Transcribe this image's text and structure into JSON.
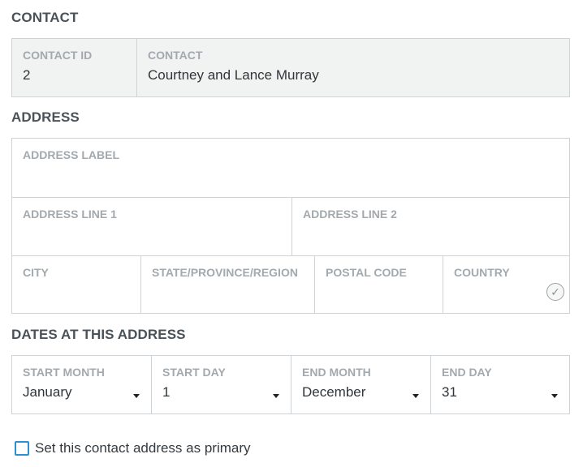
{
  "contact_section": {
    "title": "CONTACT",
    "contact_id_label": "CONTACT ID",
    "contact_id_value": "2",
    "contact_label": "CONTACT",
    "contact_value": "Courtney and Lance Murray"
  },
  "address_section": {
    "title": "ADDRESS",
    "address_label": "ADDRESS LABEL",
    "address_line1_label": "ADDRESS LINE 1",
    "address_line2_label": "ADDRESS LINE 2",
    "city_label": "CITY",
    "state_label": "STATE/PROVINCE/REGION",
    "postal_label": "POSTAL CODE",
    "country_label": "COUNTRY",
    "country_icon": "check-circle-icon"
  },
  "dates_section": {
    "title": "DATES AT THIS ADDRESS",
    "start_month_label": "START MONTH",
    "start_month_value": "January",
    "start_day_label": "START DAY",
    "start_day_value": "1",
    "end_month_label": "END MONTH",
    "end_month_value": "December",
    "end_day_label": "END DAY",
    "end_day_value": "31"
  },
  "primary": {
    "label": "Set this contact address as primary"
  },
  "colors": {
    "accent": "#2b8fd6",
    "border": "#cfd3d6",
    "label": "#a3a9ad",
    "readonly_bg": "#f1f3f3"
  }
}
